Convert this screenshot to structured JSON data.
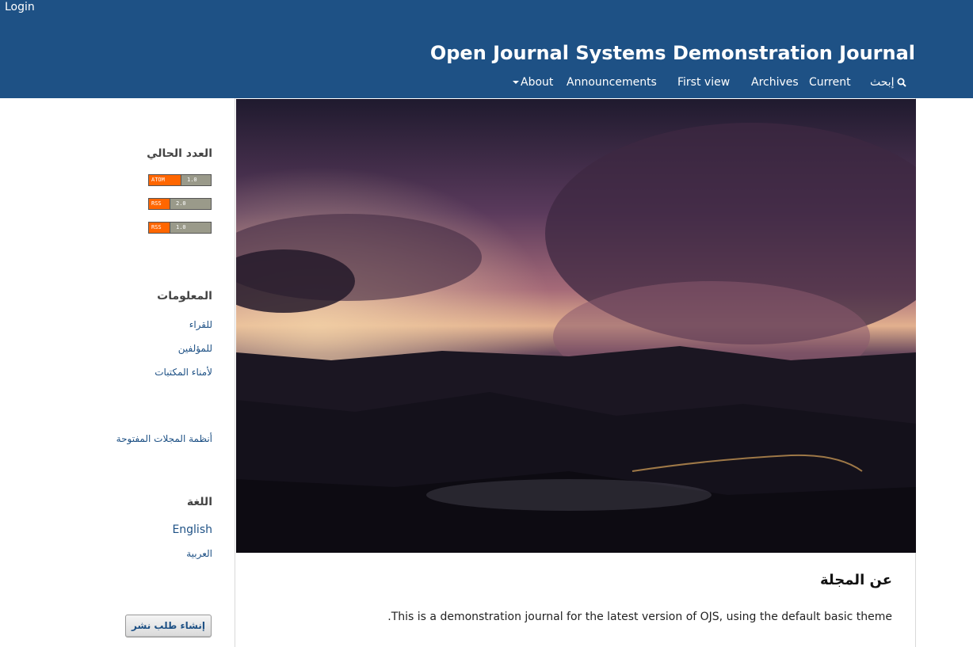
{
  "header": {
    "login_label": "Login",
    "site_title": "Open Journal Systems Demonstration Journal",
    "nav": {
      "about": "About",
      "announcements": "Announcements",
      "first_view": "First view",
      "archives": "Archives",
      "current": "Current",
      "search": "إبحث"
    },
    "background_color": "#1e5185"
  },
  "sidebar": {
    "current_issue": {
      "title": "العدد الحالي",
      "feeds": [
        {
          "left": "ATOM",
          "right": "1.0"
        },
        {
          "left": "RSS",
          "right": "2.0"
        },
        {
          "left": "RSS",
          "right": "1.0"
        }
      ]
    },
    "information": {
      "title": "المعلومات",
      "links": [
        "للقراء",
        "للمؤلفين",
        "لأمناء المكتبات"
      ]
    },
    "ojs_link": "أنظمة المجلات المفتوحة",
    "language": {
      "title": "اللغة",
      "options": [
        "English",
        "العربية"
      ]
    },
    "submit_button": "إنشاء طلب نشر"
  },
  "main": {
    "about_heading": "عن المجلة",
    "about_text": "This is a demonstration journal for the latest version of OJS, using the default basic theme."
  },
  "colors": {
    "link": "#1e5185",
    "feed_orange": "#ff6600"
  }
}
